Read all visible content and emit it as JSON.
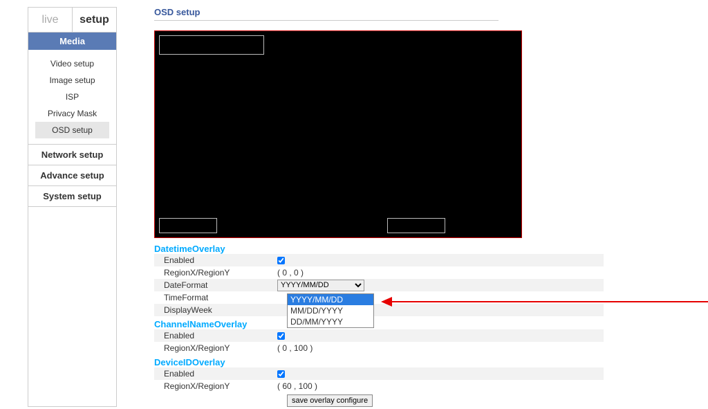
{
  "tabs": {
    "live": "live",
    "setup": "setup"
  },
  "sidebar": {
    "media": "Media",
    "items": [
      "Video setup",
      "Image setup",
      "ISP",
      "Privacy Mask",
      "OSD setup"
    ],
    "nav": [
      "Network setup",
      "Advance setup",
      "System setup"
    ]
  },
  "page": {
    "title": "OSD setup"
  },
  "groups": {
    "dt": {
      "title": "DatetimeOverlay",
      "enabled_label": "Enabled",
      "region_label": "RegionX/RegionY",
      "region_value": "( 0 ,  0 )",
      "dateformat_label": "DateFormat",
      "dateformat_value": "YYYY/MM/DD",
      "dateformat_options": [
        "YYYY/MM/DD",
        "MM/DD/YYYY",
        "DD/MM/YYYY"
      ],
      "timeformat_label": "TimeFormat",
      "displayweek_label": "DisplayWeek"
    },
    "cn": {
      "title": "ChannelNameOverlay",
      "enabled_label": "Enabled",
      "region_label": "RegionX/RegionY",
      "region_value": "( 0 ,  100 )"
    },
    "di": {
      "title": "DeviceIDOverlay",
      "enabled_label": "Enabled",
      "region_label": "RegionX/RegionY",
      "region_value": "( 60 ,  100 )"
    }
  },
  "buttons": {
    "save": "save overlay configure"
  }
}
